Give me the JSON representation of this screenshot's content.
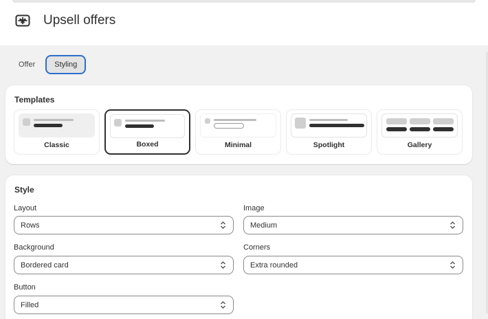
{
  "page": {
    "title": "Upsell offers",
    "title_icon": "gift-box-icon"
  },
  "tabs": [
    {
      "label": "Offer",
      "active": false
    },
    {
      "label": "Styling",
      "active": true
    }
  ],
  "templates": {
    "heading": "Templates",
    "items": [
      {
        "label": "Classic",
        "selected": false
      },
      {
        "label": "Boxed",
        "selected": true
      },
      {
        "label": "Minimal",
        "selected": false
      },
      {
        "label": "Spotlight",
        "selected": false
      },
      {
        "label": "Gallery",
        "selected": false
      }
    ]
  },
  "style": {
    "heading": "Style",
    "layout": {
      "label": "Layout",
      "value": "Rows"
    },
    "image": {
      "label": "Image",
      "value": "Medium"
    },
    "background": {
      "label": "Background",
      "value": "Bordered card"
    },
    "corners": {
      "label": "Corners",
      "value": "Extra rounded"
    },
    "button": {
      "label": "Button",
      "value": "Filled"
    }
  },
  "colors": {
    "accent_focus": "#2c6ecb",
    "text": "#303030",
    "surface": "#ffffff",
    "background": "#f1f1f1"
  }
}
